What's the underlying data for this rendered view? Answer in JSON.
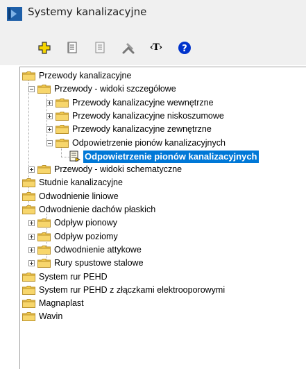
{
  "window": {
    "title": "Systemy kanalizacyjne"
  },
  "toolbar": {
    "buttons": [
      {
        "icon": "add-icon",
        "color": "#f5d400"
      },
      {
        "icon": "document-icon"
      },
      {
        "icon": "notes-icon"
      },
      {
        "icon": "tools-icon"
      },
      {
        "icon": "text-icon",
        "label": "‹T›"
      },
      {
        "icon": "help-icon",
        "label": "?",
        "color": "#0033cc"
      }
    ]
  },
  "tree": {
    "items": [
      {
        "label": "Przewody kanalizacyjne"
      },
      {
        "label": "Przewody - widoki szczegółowe"
      },
      {
        "label": "Przewody kanalizacyjne wewnętrzne"
      },
      {
        "label": "Przewody kanalizacyjne niskoszumowe"
      },
      {
        "label": "Przewody kanalizacyjne zewnętrzne"
      },
      {
        "label": "Odpowietrzenie pionów kanalizacyjnych"
      },
      {
        "label": "Odpowietrzenie pionów kanalizacyjnych",
        "selected": true
      },
      {
        "label": "Przewody - widoki schematyczne"
      },
      {
        "label": "Studnie kanalizacyjne"
      },
      {
        "label": "Odwodnienie liniowe"
      },
      {
        "label": "Odwodnienie dachów płaskich"
      },
      {
        "label": "Odpływ pionowy"
      },
      {
        "label": "Odpływ poziomy"
      },
      {
        "label": "Odwodnienie attykowe"
      },
      {
        "label": "Rury spustowe stalowe"
      },
      {
        "label": "System rur PEHD"
      },
      {
        "label": "System rur PEHD z złączkami elektrooporowymi"
      },
      {
        "label": "Magnaplast"
      },
      {
        "label": "Wavin"
      }
    ]
  },
  "colors": {
    "selection": "#0078d7",
    "folder": "#f2c94c"
  }
}
